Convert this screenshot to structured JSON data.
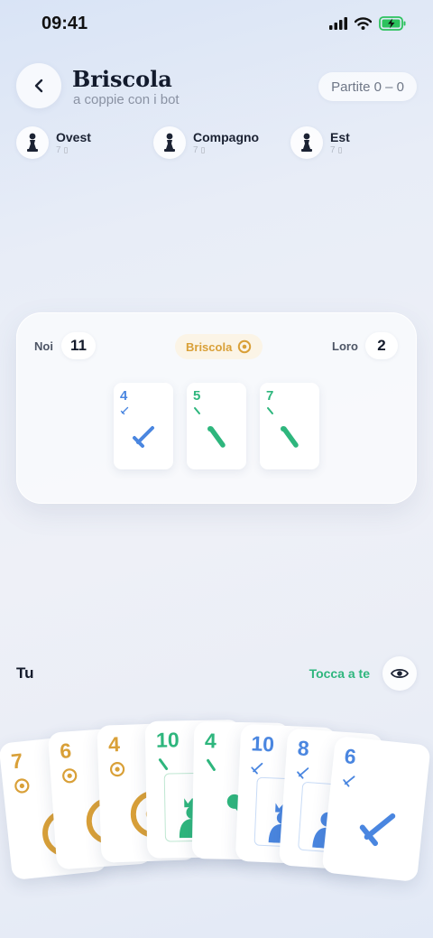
{
  "status": {
    "time": "09:41"
  },
  "header": {
    "title": "Briscola",
    "subtitle": "a coppie con i bot",
    "score_pill": "Partite 0 – 0"
  },
  "players": [
    {
      "name": "Ovest",
      "cards": "7"
    },
    {
      "name": "Compagno",
      "cards": "7"
    },
    {
      "name": "Est",
      "cards": "7"
    }
  ],
  "table": {
    "us_label": "Noi",
    "us_score": "11",
    "them_label": "Loro",
    "them_score": "2",
    "trump_label": "Briscola",
    "played": [
      {
        "rank": "4",
        "suit": "spade",
        "color": "#4a86e0"
      },
      {
        "rank": "5",
        "suit": "bastoni",
        "color": "#2eb67d"
      },
      {
        "rank": "7",
        "suit": "bastoni",
        "color": "#2eb67d"
      }
    ]
  },
  "hand": {
    "you_label": "Tu",
    "turn_label": "Tocca a te",
    "cards": [
      {
        "rank": "7",
        "suit": "denari",
        "color": "#d9a038"
      },
      {
        "rank": "6",
        "suit": "denari",
        "color": "#d9a038"
      },
      {
        "rank": "4",
        "suit": "denari",
        "color": "#d9a038"
      },
      {
        "rank": "10",
        "suit": "bastoni",
        "color": "#2eb67d"
      },
      {
        "rank": "4",
        "suit": "bastoni",
        "color": "#2eb67d"
      },
      {
        "rank": "10",
        "suit": "spade",
        "color": "#4a86e0"
      },
      {
        "rank": "8",
        "suit": "spade",
        "color": "#4a86e0"
      },
      {
        "rank": "6",
        "suit": "spade",
        "color": "#4a86e0"
      }
    ]
  },
  "colors": {
    "denari": "#d9a038",
    "bastoni": "#2eb67d",
    "spade": "#4a86e0",
    "turn": "#2eb67d"
  },
  "icons": [
    "back-arrow-icon",
    "pawn-icon",
    "coin-icon",
    "eye-icon",
    "signal-icon",
    "wifi-icon",
    "battery-icon"
  ]
}
